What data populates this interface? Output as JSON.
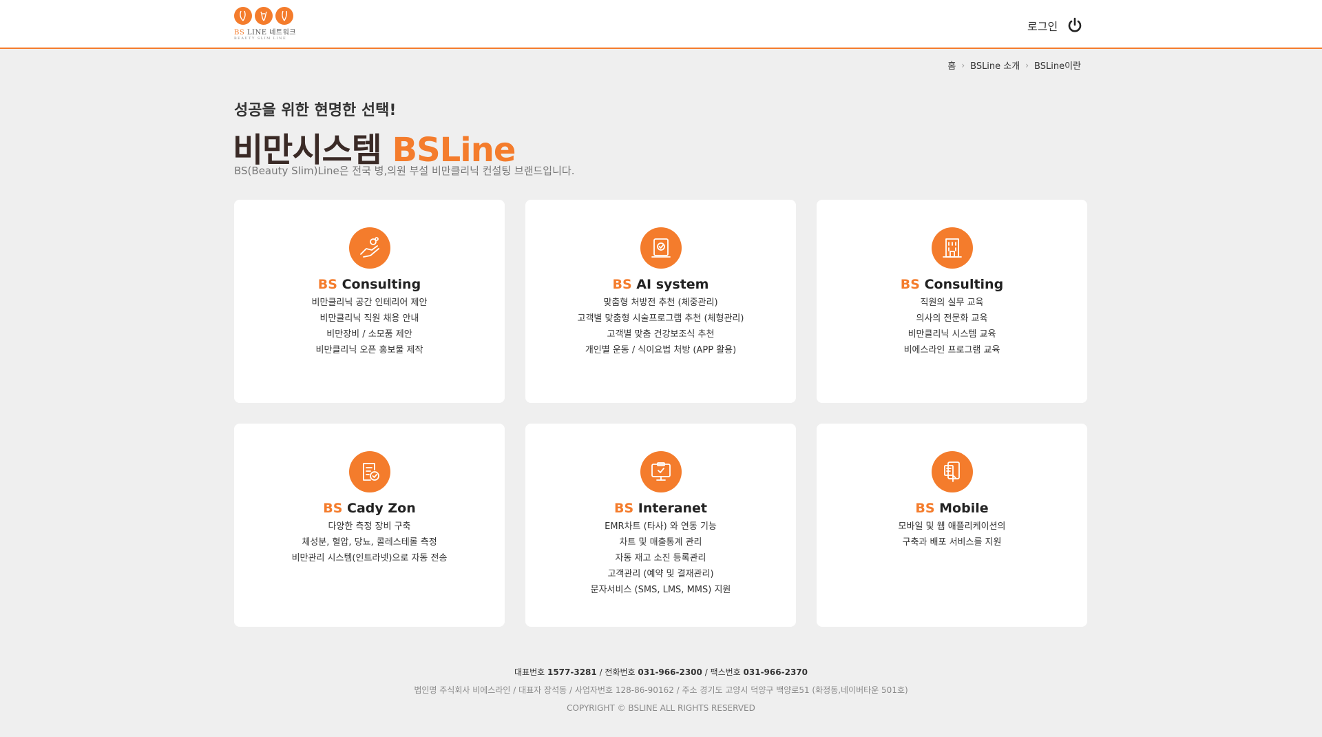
{
  "brand": {
    "logo_prefix": "BS",
    "logo_main": " LINE 네트워크",
    "logo_tagline": "BEAUTY SLIM LINE",
    "accent_color": "#f47c2c"
  },
  "header": {
    "login_label": "로그인"
  },
  "breadcrumb": {
    "items": [
      "홈",
      "BSLine 소개",
      "BSLine이란"
    ]
  },
  "hero": {
    "kicker": "성공을 위한 현명한 선택!",
    "title_main": "비만시스템 ",
    "title_accent": "BSLine",
    "description": "BS(Beauty Slim)Line은 전국 병,의원 부설 비만클리닉 컨설팅 브랜드입니다."
  },
  "cards": [
    {
      "icon": "hand-coin-icon",
      "prefix": "BS",
      "title": " Consulting",
      "lines": [
        "비만클리닉 공간 인테리어 제안",
        "비만클리닉 직원 채용 안내",
        "비만장비 / 소모품 제안",
        "비만클리닉 오픈 홍보물 제작"
      ]
    },
    {
      "icon": "document-check-icon",
      "prefix": "BS",
      "title": " AI system",
      "lines": [
        "맞춤형 처방전 추천 (체중관리)",
        "고객별 맞춤형 시술프로그램 추천 (체형관리)",
        "고객별 맞춤 건강보조식 추천",
        "개인별 운동 / 식이요법 처방 (APP 활용)"
      ]
    },
    {
      "icon": "building-icon",
      "prefix": "BS",
      "title": " Consulting",
      "lines": [
        "직원의 실무 교육",
        "의사의 전문화 교육",
        "비만클리닉 시스템 교육",
        "비에스라인 프로그램 교육"
      ]
    },
    {
      "icon": "clipboard-check-icon",
      "prefix": "BS",
      "title": " Cady Zon",
      "lines": [
        "다양한 측정 장비 구축",
        "체성분, 혈압, 당뇨, 콜레스테롤 측정",
        "비만관리 시스템(인트라넷)으로 자동 전송"
      ]
    },
    {
      "icon": "monitor-check-icon",
      "prefix": "BS",
      "title": " Interanet",
      "lines": [
        "EMR차트 (타사) 와 연동 기능",
        "차트 및 매출통계 관리",
        "자동 재고 소진 등록관리",
        "고객관리 (예약 및 결재관리)",
        "문자서비스 (SMS, LMS, MMS) 지원"
      ]
    },
    {
      "icon": "mobile-touch-icon",
      "prefix": "BS",
      "title": " Mobile",
      "lines": [
        "모바일 및 웹 애플리케이션의",
        "구축과 배포 서비스를 지원"
      ]
    }
  ],
  "footer": {
    "rep_label": "대표번호 ",
    "rep_number": "1577-3281",
    "tel_label": " / 전화번호 ",
    "tel_number": "031-966-2300",
    "fax_label": "  / 팩스번호 ",
    "fax_number": "031-966-2370",
    "company_info": "법인명 주식회사 비에스라인  / 대표자 장석동  / 사업자번호 128-86-90162  / 주소 경기도 고양시 덕양구 백양로51 (화정동,네이버타운 501호)",
    "copyright": "COPYRIGHT © BSLINE ALL RIGHTS RESERVED"
  }
}
